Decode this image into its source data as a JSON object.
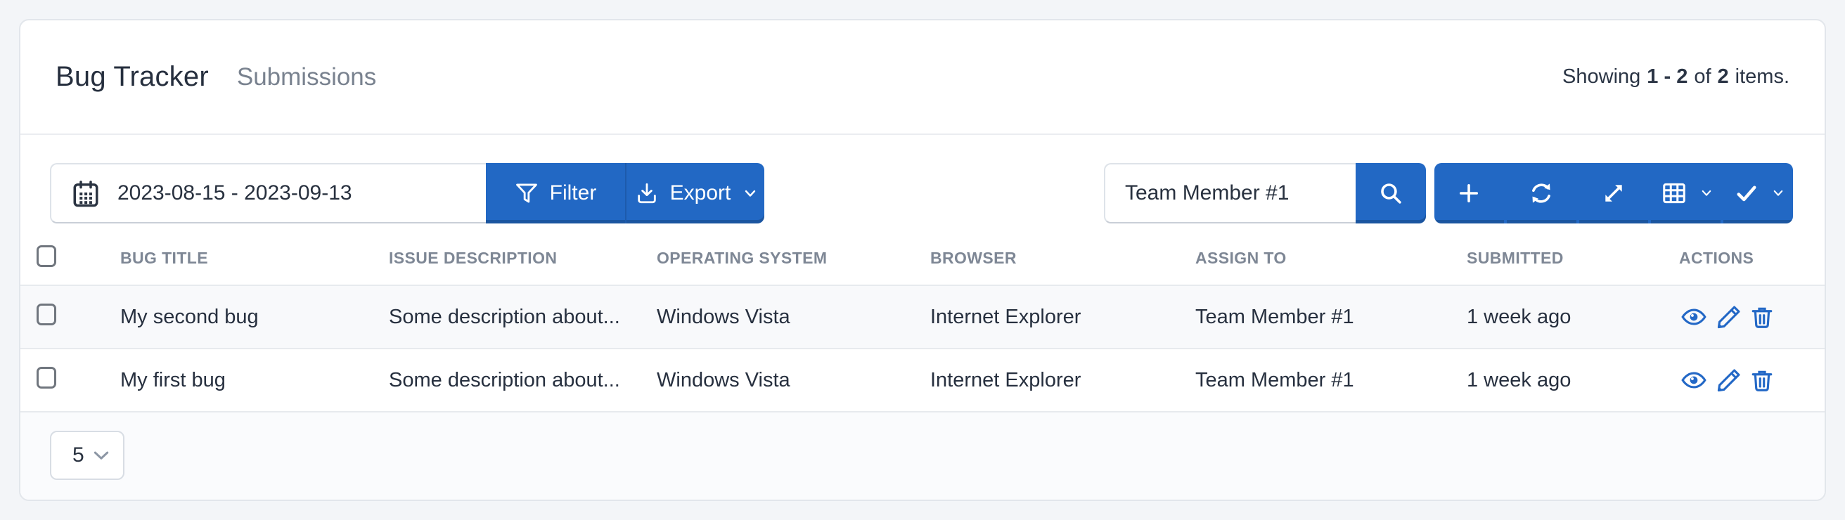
{
  "header": {
    "title": "Bug Tracker",
    "subtitle": "Submissions",
    "summary": {
      "showing": "Showing",
      "range": "1 - 2",
      "of": "of",
      "total": "2",
      "items": "items."
    }
  },
  "toolbar": {
    "date_range": {
      "value": "2023-08-15 - 2023-09-13",
      "icon": "calendar-icon"
    },
    "filter": {
      "label": "Filter",
      "icon": "filter-funnel-icon"
    },
    "export": {
      "label": "Export",
      "icon": "download-icon",
      "has_dropdown": true
    },
    "search": {
      "value": "Team Member #1",
      "button_icon": "search-icon"
    },
    "grid_buttons": [
      {
        "name": "add",
        "icon": "plus-icon"
      },
      {
        "name": "refresh",
        "icon": "refresh-icon"
      },
      {
        "name": "expand",
        "icon": "expand-icon"
      },
      {
        "name": "toggle-columns",
        "icon": "table-grid-icon",
        "has_dropdown": true
      },
      {
        "name": "bulk-select",
        "icon": "check-icon",
        "has_dropdown": true
      }
    ]
  },
  "table": {
    "columns": [
      "BUG TITLE",
      "ISSUE DESCRIPTION",
      "OPERATING SYSTEM",
      "BROWSER",
      "ASSIGN TO",
      "SUBMITTED",
      "ACTIONS"
    ],
    "rows": [
      {
        "bug_title": "My second bug",
        "issue_description": "Some description about...",
        "operating_system": "Windows Vista",
        "browser": "Internet Explorer",
        "assign_to": "Team Member #1",
        "submitted": "1 week ago",
        "actions": [
          "view",
          "update",
          "delete"
        ]
      },
      {
        "bug_title": "My first bug",
        "issue_description": "Some description about...",
        "operating_system": "Windows Vista",
        "browser": "Internet Explorer",
        "assign_to": "Team Member #1",
        "submitted": "1 week ago",
        "actions": [
          "view",
          "update",
          "delete"
        ]
      }
    ]
  },
  "footer": {
    "page_size": "5"
  },
  "colors": {
    "primary": "#2268c4",
    "page_bg": "#f3f5f8",
    "text_dark": "#27303f",
    "text_muted": "#79828f",
    "table_header_text": "#7e8795",
    "row_stripe": "#f8f9fb",
    "border": "#e7eaee",
    "action_icon": "#2368c6"
  }
}
